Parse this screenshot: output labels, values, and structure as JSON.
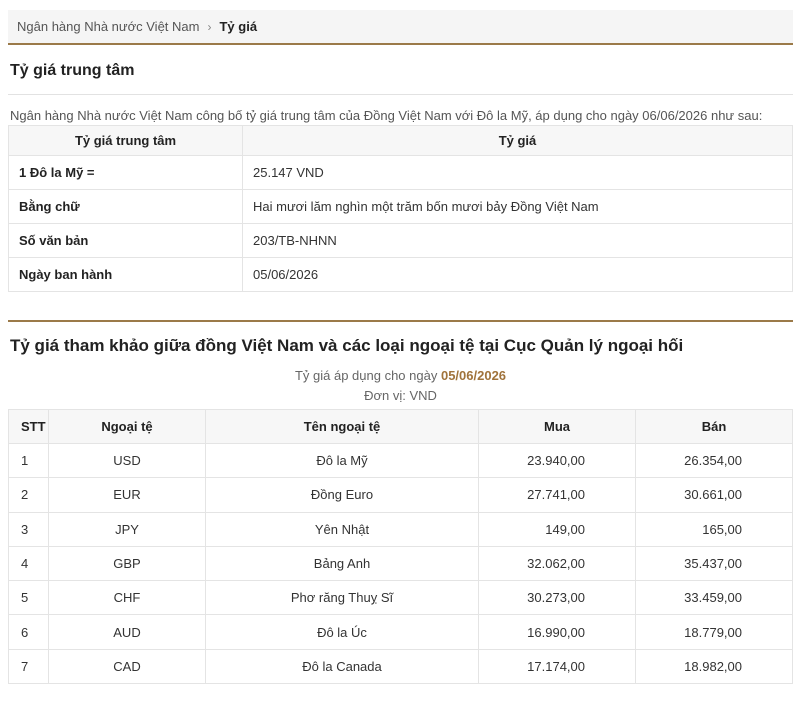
{
  "breadcrumb": {
    "home": "Ngân hàng Nhà nước Việt Nam",
    "separator": "›",
    "current": "Tỷ giá"
  },
  "central": {
    "title": "Tỷ giá trung tâm",
    "intro": "Ngân hàng Nhà nước Việt Nam công bố tỷ giá trung tâm của Đồng Việt Nam với Đô la Mỹ, áp dụng cho ngày 06/06/2026 như sau:",
    "headers": [
      "Tỷ giá trung tâm",
      "Tỷ giá"
    ],
    "rows": [
      {
        "key": "1 Đô la Mỹ =",
        "value": "25.147 VND"
      },
      {
        "key": "Bằng chữ",
        "value": "Hai mươi lăm nghìn một trăm bốn mươi bảy Đồng Việt Nam"
      },
      {
        "key": "Số văn bản",
        "value": "203/TB-NHNN"
      },
      {
        "key": "Ngày ban hành",
        "value": "05/06/2026"
      }
    ]
  },
  "reference": {
    "title": "Tỷ giá tham khảo giữa đồng Việt Nam và các loại ngoại tệ tại Cục Quản lý ngoại hối",
    "apply_prefix": "Tỷ giá áp dụng cho ngày",
    "apply_date": "05/06/2026",
    "unit": "Đơn vị: VND",
    "headers": [
      "STT",
      "Ngoại tệ",
      "Tên ngoại tệ",
      "Mua",
      "Bán"
    ],
    "rows": [
      {
        "stt": "1",
        "code": "USD",
        "name": "Đô la Mỹ",
        "buy": "23.940,00",
        "sell": "26.354,00"
      },
      {
        "stt": "2",
        "code": "EUR",
        "name": "Đồng Euro",
        "buy": "27.741,00",
        "sell": "30.661,00"
      },
      {
        "stt": "3",
        "code": "JPY",
        "name": "Yên Nhật",
        "buy": "149,00",
        "sell": "165,00"
      },
      {
        "stt": "4",
        "code": "GBP",
        "name": "Bảng Anh",
        "buy": "32.062,00",
        "sell": "35.437,00"
      },
      {
        "stt": "5",
        "code": "CHF",
        "name": "Phơ răng Thuỵ Sĩ",
        "buy": "30.273,00",
        "sell": "33.459,00"
      },
      {
        "stt": "6",
        "code": "AUD",
        "name": "Đô la Úc",
        "buy": "16.990,00",
        "sell": "18.779,00"
      },
      {
        "stt": "7",
        "code": "CAD",
        "name": "Đô la Canada",
        "buy": "17.174,00",
        "sell": "18.982,00"
      }
    ]
  }
}
